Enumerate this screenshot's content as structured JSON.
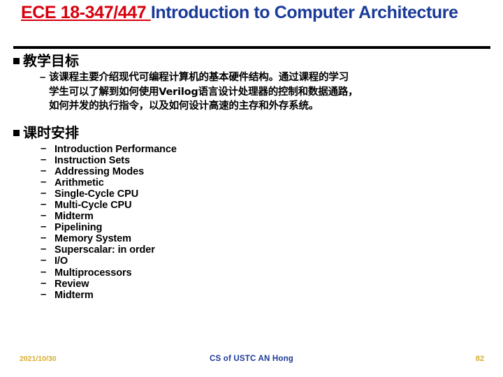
{
  "slide": {
    "title": {
      "code": "ECE 18-347/447 ",
      "rest": "Introduction to Computer Architecture",
      "code_color": "#D8000E",
      "rest_color": "#1A3A99"
    },
    "sections": [
      {
        "heading": "教学目标",
        "bullet_marker": "■",
        "paragraph": {
          "marker": "–",
          "lines": [
            "该课程主要介绍现代可编程计算机的基本硬件结构。通过课程的学习",
            "学生可以了解到如何使用Verilog语言设计处理器的控制和数据通路，",
            "如何并发的执行指令，以及如何设计高速的主存和外存系统。"
          ]
        }
      },
      {
        "heading": "课时安排",
        "bullet_marker": "■",
        "items_marker": "–",
        "items": [
          "Introduction Performance",
          "Instruction Sets",
          "Addressing Modes",
          "Arithmetic",
          "Single-Cycle CPU",
          "Multi-Cycle CPU",
          "Midterm",
          "Pipelining",
          "Memory System",
          "Superscalar: in order",
          "I/O",
          "Multiprocessors",
          "Review",
          "Midterm"
        ]
      }
    ],
    "footer": {
      "date": "2021/10/30",
      "center": "CS of USTC AN Hong",
      "page": "82",
      "accent_color": "#D6AE2E",
      "center_color": "#1A3A99"
    }
  }
}
